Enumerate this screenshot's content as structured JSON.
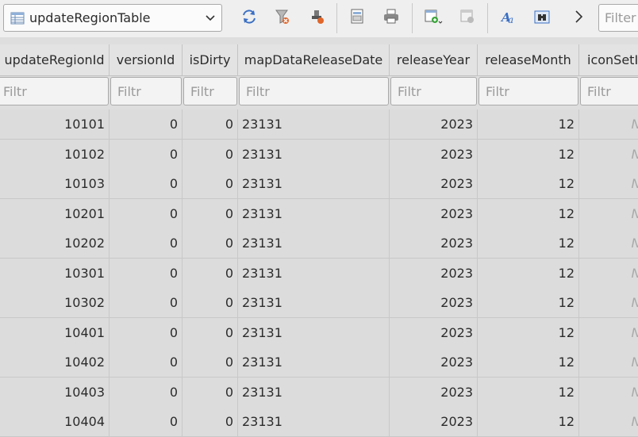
{
  "toolbar": {
    "table_name": "updateRegionTable",
    "filter_placeholder": "Filter",
    "icons": [
      "refresh-icon",
      "clear-filters-icon",
      "save-filter-icon",
      "print-icon",
      "export-icon",
      "insert-record-icon",
      "delete-record-icon",
      "find-replace-icon",
      "binoculars-icon",
      "chevron-right-icon"
    ]
  },
  "columns": [
    {
      "label": "updateRegionId",
      "align": "right"
    },
    {
      "label": "versionId",
      "align": "right"
    },
    {
      "label": "isDirty",
      "align": "right"
    },
    {
      "label": "mapDataReleaseDate",
      "align": "left"
    },
    {
      "label": "releaseYear",
      "align": "right"
    },
    {
      "label": "releaseMonth",
      "align": "right"
    },
    {
      "label": "iconSetId",
      "align": "right"
    }
  ],
  "filter_placeholder": "Filtr",
  "rows": [
    [
      "10101",
      "0",
      "0",
      "23131",
      "2023",
      "12",
      "NULL"
    ],
    [
      "10102",
      "0",
      "0",
      "23131",
      "2023",
      "12",
      "NULL"
    ],
    [
      "10103",
      "0",
      "0",
      "23131",
      "2023",
      "12",
      "NULL"
    ],
    [
      "10201",
      "0",
      "0",
      "23131",
      "2023",
      "12",
      "NULL"
    ],
    [
      "10202",
      "0",
      "0",
      "23131",
      "2023",
      "12",
      "NULL"
    ],
    [
      "10301",
      "0",
      "0",
      "23131",
      "2023",
      "12",
      "NULL"
    ],
    [
      "10302",
      "0",
      "0",
      "23131",
      "2023",
      "12",
      "NULL"
    ],
    [
      "10401",
      "0",
      "0",
      "23131",
      "2023",
      "12",
      "NULL"
    ],
    [
      "10402",
      "0",
      "0",
      "23131",
      "2023",
      "12",
      "NULL"
    ],
    [
      "10403",
      "0",
      "0",
      "23131",
      "2023",
      "12",
      "NULL"
    ],
    [
      "10404",
      "0",
      "0",
      "23131",
      "2023",
      "12",
      "NULL"
    ]
  ],
  "colors": {
    "toolbar_bg": "#efefef",
    "grid_bg": "#dcdcdc",
    "null_text": "#a8a8a8",
    "icon_blue": "#3a6fc4"
  }
}
